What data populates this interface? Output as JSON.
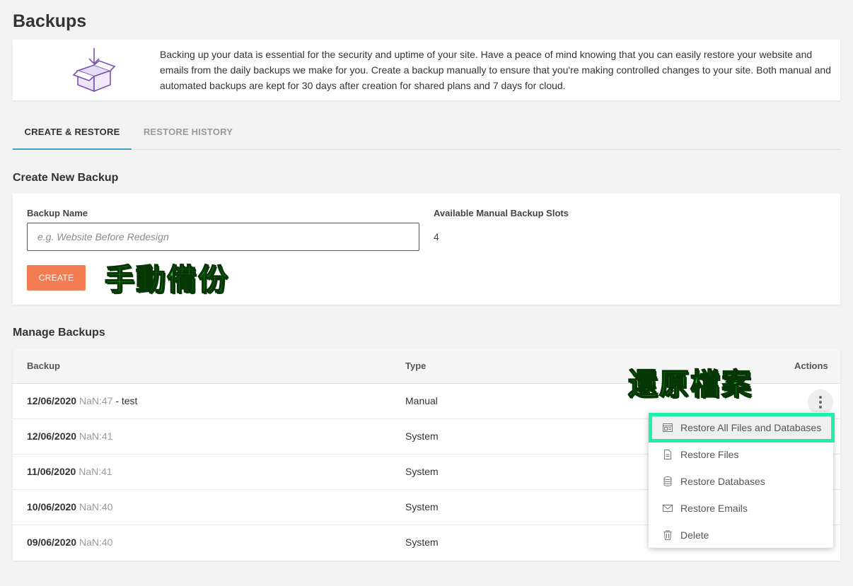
{
  "page": {
    "title": "Backups",
    "intro": "Backing up your data is essential for the security and uptime of your site. Have a peace of mind knowing that you can easily restore your website and emails from the daily backups we make for you. Create a backup manually to ensure that you're making controlled changes to your site. Both manual and automated backups are kept for 30 days after creation for shared plans and 7 days for cloud.",
    "icon": "box-download-icon"
  },
  "tabs": [
    {
      "label": "CREATE & RESTORE",
      "active": true
    },
    {
      "label": "RESTORE HISTORY",
      "active": false
    }
  ],
  "create": {
    "section_title": "Create New Backup",
    "name_label": "Backup Name",
    "name_placeholder": "e.g. Website Before Redesign",
    "name_value": "",
    "slots_label": "Available Manual Backup Slots",
    "slots_value": "4",
    "button_label": "CREATE"
  },
  "annotations": {
    "manual_backup": "手動備份",
    "restore_files": "還原檔案"
  },
  "manage": {
    "section_title": "Manage Backups",
    "columns": {
      "backup": "Backup",
      "type": "Type",
      "actions": "Actions"
    },
    "rows": [
      {
        "date": "12/06/2020",
        "time": "NaN:47",
        "suffix": " - test",
        "type": "Manual"
      },
      {
        "date": "12/06/2020",
        "time": "NaN:41",
        "suffix": "",
        "type": "System"
      },
      {
        "date": "11/06/2020",
        "time": "NaN:41",
        "suffix": "",
        "type": "System"
      },
      {
        "date": "10/06/2020",
        "time": "NaN:40",
        "suffix": "",
        "type": "System"
      },
      {
        "date": "09/06/2020",
        "time": "NaN:40",
        "suffix": "",
        "type": "System"
      }
    ]
  },
  "actions_menu": {
    "items": [
      {
        "label": "Restore All Files and Databases",
        "icon": "restore-all-icon"
      },
      {
        "label": "Restore Files",
        "icon": "file-icon"
      },
      {
        "label": "Restore Databases",
        "icon": "database-icon"
      },
      {
        "label": "Restore Emails",
        "icon": "envelope-icon"
      },
      {
        "label": "Delete",
        "icon": "trash-icon"
      }
    ]
  },
  "colors": {
    "accent": "#f47c52",
    "tab_underline": "#3aa0c8",
    "annotation_text": "#14e01f",
    "highlight_box": "#20f0a6",
    "icon_purple": "#7b4fb0"
  }
}
